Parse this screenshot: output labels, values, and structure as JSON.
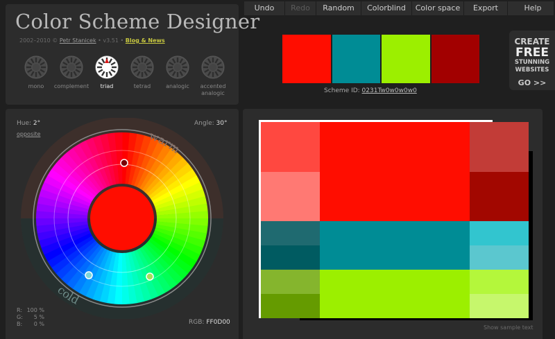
{
  "app": {
    "title": "Color Scheme Designer",
    "credit_prefix": "2002–2010 © ",
    "author": "Petr Stanicek",
    "version": " • v3.51 • ",
    "blog": "Blog & News"
  },
  "menu": [
    {
      "label": "Undo",
      "enabled": true
    },
    {
      "label": "Redo",
      "enabled": false
    },
    {
      "label": "Random",
      "enabled": true
    },
    {
      "label": "Colorblind",
      "enabled": true
    },
    {
      "label": "Color space",
      "enabled": true
    },
    {
      "label": "Export",
      "enabled": true
    },
    {
      "label": "Help",
      "enabled": true
    }
  ],
  "modes": [
    {
      "label": "mono",
      "active": false
    },
    {
      "label": "complement",
      "active": false
    },
    {
      "label": "triad",
      "active": true
    },
    {
      "label": "tetrad",
      "active": false
    },
    {
      "label": "analogic",
      "active": false
    },
    {
      "label": "accented analogic",
      "active": false
    }
  ],
  "scheme": {
    "swatches": [
      "#FF0D00",
      "#008C95",
      "#9CEF00",
      "#A20000"
    ],
    "id_label": "Scheme ID: ",
    "id_value": "0231Tw0w0w0w0"
  },
  "ad": {
    "line1": "CREATE",
    "line2": "FREE",
    "line3": "STUNNING",
    "line4": "WEBSITES",
    "cta": "GO >>"
  },
  "wheel": {
    "hue_label": "Hue:",
    "hue_value": "2°",
    "opposite": "opposite",
    "angle_label": "Angle:",
    "angle_value": "30°",
    "warm": "warm",
    "cold": "cold",
    "rgb": [
      {
        "k": "R:",
        "v": "100 %"
      },
      {
        "k": "G:",
        "v": "5 %"
      },
      {
        "k": "B:",
        "v": "0 %"
      }
    ],
    "rgb_hex_label": "RGB:",
    "rgb_hex_value": "FF0D00",
    "center_color": "#FF0D00"
  },
  "preview": {
    "show_sample": "Show sample text",
    "primary": {
      "main": "#FF0D00",
      "left": [
        "#FF4840",
        "#FF7973"
      ],
      "right": [
        "#C23C37",
        "#A20700"
      ]
    },
    "secondary1": {
      "main": "#008C95",
      "left": [
        "#1F6A70",
        "#005B61"
      ],
      "right": [
        "#32C5CF",
        "#5BC7CF"
      ]
    },
    "secondary2": {
      "main": "#9CEF00",
      "left": [
        "#85B52D",
        "#659B00"
      ],
      "right": [
        "#B4F73B",
        "#C6F76C"
      ]
    }
  }
}
